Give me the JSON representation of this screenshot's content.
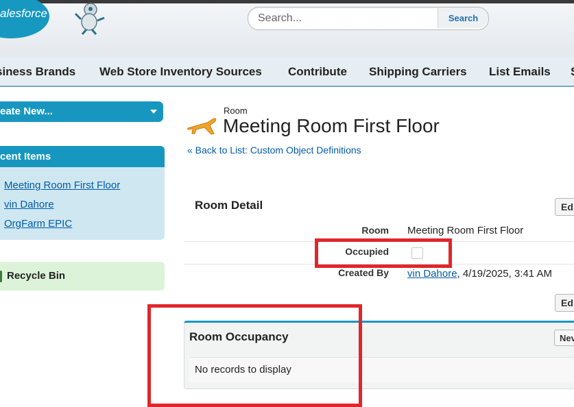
{
  "header": {
    "logo_text": "alesforce",
    "search": {
      "placeholder": "Search...",
      "button_label": "Search"
    }
  },
  "nav": {
    "tabs": [
      "siness Brands",
      "Web Store Inventory Sources",
      "Contribute",
      "Shipping Carriers",
      "List Emails",
      "S"
    ]
  },
  "sidebar": {
    "create_new": "eate New...",
    "recent_items_title": "cent Items",
    "recent_items": [
      "Meeting Room First Floor",
      "vin Dahore",
      "OrgFarm EPIC"
    ],
    "recycle_bin": "Recycle Bin"
  },
  "page": {
    "object_type": "Room",
    "title": "Meeting Room First Floor",
    "back_link": "« Back to List: Custom Object Definitions"
  },
  "detail": {
    "section_title": "Room Detail",
    "edit_label": "Ed",
    "fields": {
      "room_label": "Room",
      "room_value": "Meeting Room First Floor",
      "occupied_label": "Occupied",
      "occupied_checked": false,
      "created_by_label": "Created By",
      "created_by_user": "vin Dahore",
      "created_by_date": ", 4/19/2025, 3:41 AM"
    }
  },
  "related_list": {
    "title": "Room Occupancy",
    "new_label": "Nev",
    "empty_message": "No records to display"
  },
  "colors": {
    "brand_blue": "#1797c0",
    "link": "#015ba7",
    "highlight_red": "#e0262b",
    "recycle_green": "#dcf3d9"
  }
}
